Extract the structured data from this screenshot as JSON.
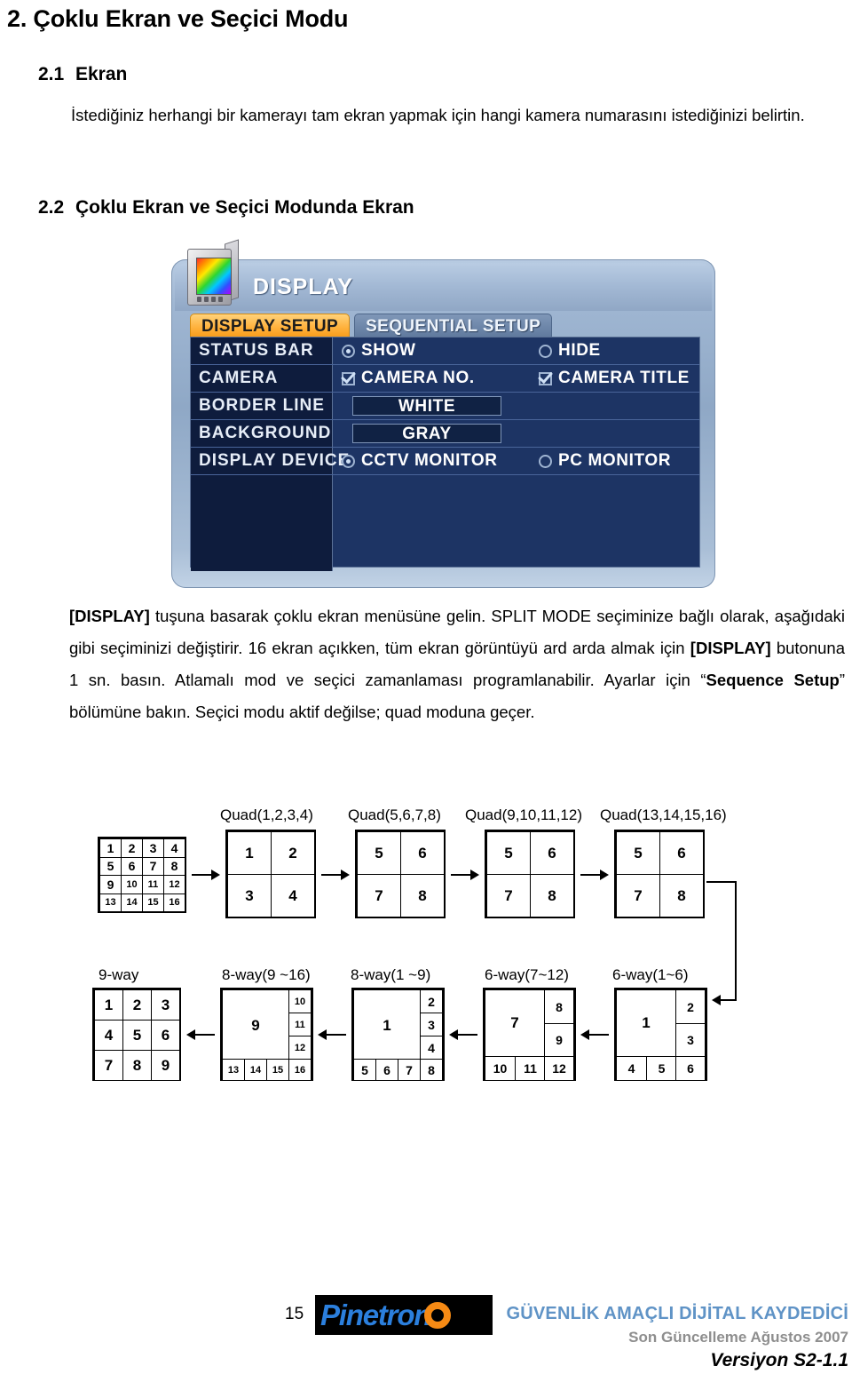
{
  "document": {
    "chapter_heading": "2. Çoklu Ekran ve Seçici Modu",
    "sections": [
      {
        "number": "2.1",
        "title": "Ekran"
      },
      {
        "number": "2.2",
        "title": "Çoklu Ekran ve Seçici Modunda Ekran"
      }
    ],
    "intro_paragraph": "İstediğiniz herhangi bir kamerayı tam ekran yapmak için hangi kamera numarasını istediğinizi belirtin.",
    "body_paragraph": {
      "p1": "[DISPLAY]",
      "p2": " tuşuna basarak çoklu ekran menüsüne gelin. SPLIT MODE seçiminize bağlı olarak, aşağıdaki gibi seçiminizi değiştirir. 16 ekran açıkken, tüm ekran görüntüyü ard arda almak için ",
      "p3": "[DISPLAY]",
      "p4": " butonuna 1 sn. basın. Atlamalı mod ve seçici zamanlaması programlanabilir. Ayarlar için “",
      "p5": "Sequence Setup",
      "p6": "” bölümüne bakın. Seçici modu aktif değilse; quad moduna geçer."
    }
  },
  "dvr_panel": {
    "title": "DISPLAY",
    "icon": "monitor-icon",
    "tabs": [
      {
        "label": "DISPLAY SETUP",
        "active": true
      },
      {
        "label": "SEQUENTIAL SETUP",
        "active": false
      }
    ],
    "rows": [
      {
        "label": "STATUS BAR",
        "type": "radio",
        "options": [
          {
            "label": "SHOW",
            "selected": true
          },
          {
            "label": "HIDE",
            "selected": false
          }
        ]
      },
      {
        "label": "CAMERA",
        "type": "checkbox",
        "options": [
          {
            "label": "CAMERA NO.",
            "selected": true
          },
          {
            "label": "CAMERA TITLE",
            "selected": true
          }
        ]
      },
      {
        "label": "BORDER LINE",
        "type": "value",
        "value": "WHITE"
      },
      {
        "label": "BACKGROUND",
        "type": "value",
        "value": "GRAY"
      },
      {
        "label": "DISPLAY DEVICE",
        "type": "radio",
        "options": [
          {
            "label": "CCTV MONITOR",
            "selected": true
          },
          {
            "label": "PC MONITOR",
            "selected": false
          }
        ]
      }
    ],
    "colors": {
      "shell": "#9fb6d2",
      "body": "#1d3464",
      "label_cell": "#0e1c3d",
      "tab_active": "#ffb13c",
      "tab_inactive": "#5e789c"
    }
  },
  "diagram": {
    "row1": {
      "source": {
        "caption": "",
        "cells": [
          "1",
          "2",
          "3",
          "4",
          "5",
          "6",
          "7",
          "8",
          "9",
          "10",
          "11",
          "12",
          "13",
          "14",
          "15",
          "16"
        ]
      },
      "quads": [
        {
          "caption": "Quad(1,2,3,4)",
          "cells": [
            "1",
            "2",
            "3",
            "4"
          ]
        },
        {
          "caption": "Quad(5,6,7,8)",
          "cells": [
            "5",
            "6",
            "7",
            "8"
          ]
        },
        {
          "caption": "Quad(9,10,11,12)",
          "cells": [
            "5",
            "6",
            "7",
            "8"
          ]
        },
        {
          "caption": "Quad(13,14,15,16)",
          "cells": [
            "5",
            "6",
            "7",
            "8"
          ]
        }
      ]
    },
    "row2": {
      "nine_way": {
        "caption": "9-way",
        "cells": [
          "1",
          "2",
          "3",
          "4",
          "5",
          "6",
          "7",
          "8",
          "9"
        ]
      },
      "eight_a": {
        "caption": "8-way(9 ~16)",
        "main": "9",
        "right": [
          "10",
          "11",
          "12"
        ],
        "bottom": [
          "13",
          "14",
          "15",
          "16"
        ]
      },
      "eight_b": {
        "caption": "8-way(1 ~9)",
        "main": "1",
        "right": [
          "2",
          "3",
          "4"
        ],
        "bottom": [
          "5",
          "6",
          "7",
          "8"
        ]
      },
      "six_a": {
        "caption": "6-way(7~12)",
        "main": "7",
        "right": [
          "8",
          "9"
        ],
        "bottom": [
          "10",
          "11",
          "12"
        ]
      },
      "six_b": {
        "caption": "6-way(1~6)",
        "main": "1",
        "right": [
          "2",
          "3"
        ],
        "bottom": [
          "4",
          "5",
          "6"
        ]
      }
    }
  },
  "footer": {
    "page_number": "15",
    "logo_text": "Pinetron",
    "tagline": "GÜVENLİK AMAÇLI DİJİTAL KAYDEDİCİ",
    "last_update": "Son Güncelleme Ağustos 2007",
    "version": "Versiyon S2-1.1",
    "colors": {
      "tagline": "#5f93c6",
      "last_update": "#8e8e8e",
      "logo_blue": "#2b7fdd",
      "logo_orange": "#f68a14"
    }
  }
}
